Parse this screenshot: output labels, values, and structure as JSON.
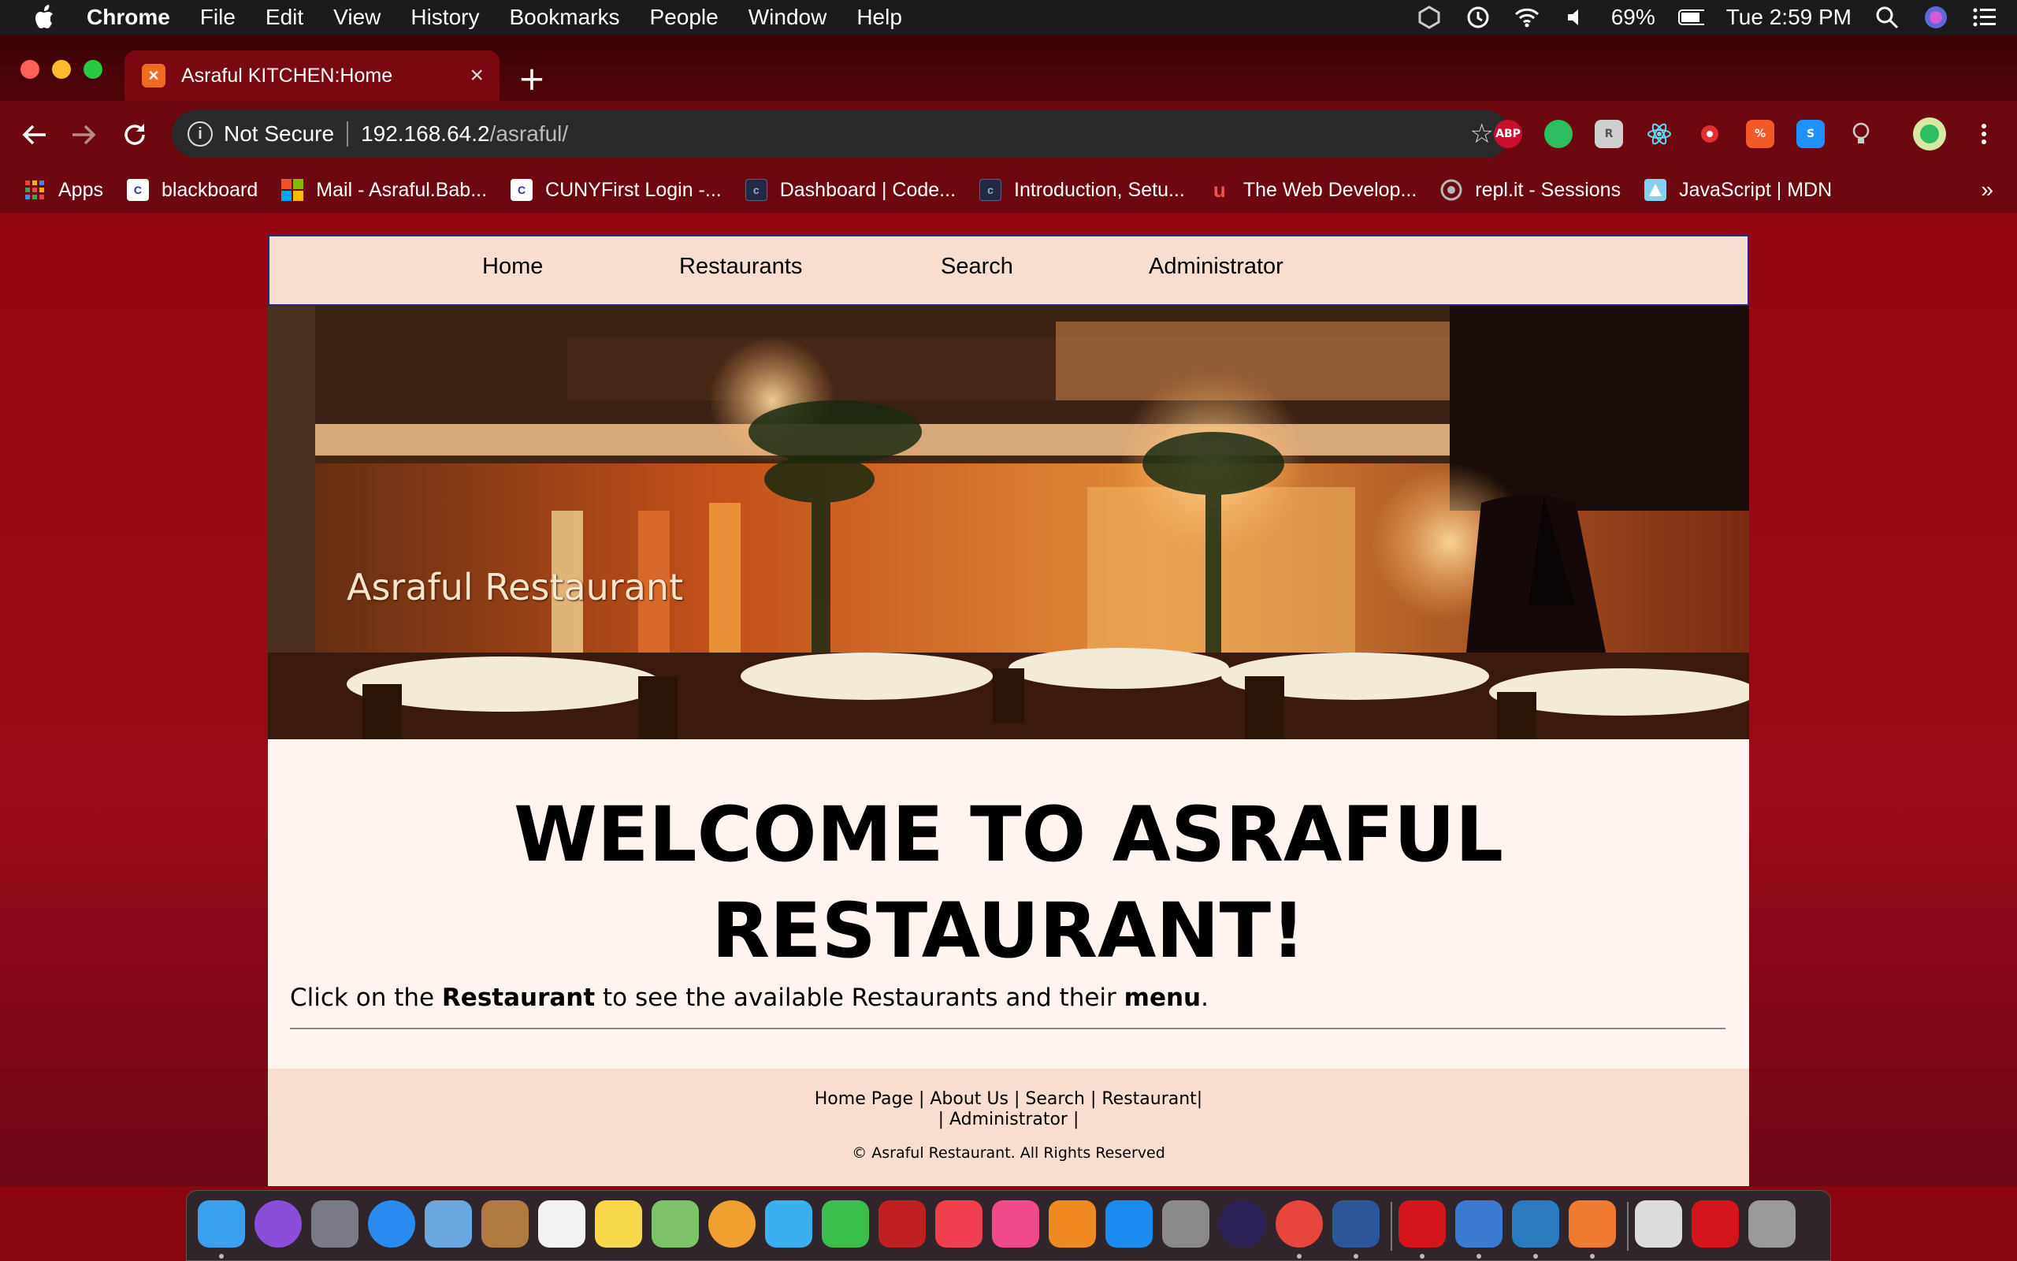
{
  "menubar": {
    "app_name": "Chrome",
    "items": [
      "File",
      "Edit",
      "View",
      "History",
      "Bookmarks",
      "People",
      "Window",
      "Help"
    ],
    "battery": "69%",
    "clock": "Tue 2:59 PM"
  },
  "browser": {
    "tab_title": "Asraful KITCHEN:Home",
    "security_label": "Not Secure",
    "url_host": "192.168.64.2",
    "url_path": "/asraful/",
    "extensions": [
      {
        "name": "adblock-icon",
        "text": "ABP",
        "color": "#c8102e"
      },
      {
        "name": "evernote-icon",
        "text": "",
        "color": "#2dbe60"
      },
      {
        "name": "extension-icon",
        "text": "R",
        "color": "#cfcfcf"
      },
      {
        "name": "react-devtools-icon",
        "text": "",
        "color": "#61dafb"
      },
      {
        "name": "extension-red-icon",
        "text": "",
        "color": "#e03030"
      },
      {
        "name": "extension-orange-icon",
        "text": "%",
        "color": "#f05a28"
      },
      {
        "name": "extension-blue-icon",
        "text": "S",
        "color": "#1e90ff"
      },
      {
        "name": "lightbulb-icon",
        "text": "",
        "color": "#777"
      }
    ]
  },
  "bookmarks": [
    {
      "label": "Apps",
      "icon": "apps-grid-icon",
      "color": "#e8453c"
    },
    {
      "label": "blackboard",
      "icon": "cuny-icon",
      "color": "#1f3a93"
    },
    {
      "label": "Mail - Asraful.Bab...",
      "icon": "microsoft-icon",
      "color": "#f25022"
    },
    {
      "label": "CUNYFirst Login -...",
      "icon": "cuny-icon",
      "color": "#1f3a93"
    },
    {
      "label": "Dashboard | Code...",
      "icon": "codecademy-icon",
      "color": "#1f2a44"
    },
    {
      "label": "Introduction, Setu...",
      "icon": "codecademy-icon",
      "color": "#1f2a44"
    },
    {
      "label": "The Web Develop...",
      "icon": "udemy-icon",
      "color": "#ec5252"
    },
    {
      "label": "repl.it - Sessions",
      "icon": "replit-icon",
      "color": "#667881"
    },
    {
      "label": "JavaScript | MDN",
      "icon": "mdn-icon",
      "color": "#83d0f2"
    }
  ],
  "site": {
    "nav": [
      "Home",
      "Restaurants",
      "Search",
      "Administrator"
    ],
    "hero_title": "Asraful Restaurant",
    "welcome_line1": "WELCOME TO ASRAFUL",
    "welcome_line2": "RESTAURANT!",
    "intro_pre": "Click on the ",
    "intro_bold1": "Restaurant",
    "intro_mid": " to see the available Restaurants and their ",
    "intro_bold2": "menu",
    "intro_post": ".",
    "footer_links1": "Home Page | About Us | Search | Restaurant|",
    "footer_links2": "| Administrator |",
    "footer_copy": "© Asraful Restaurant. All Rights Reserved"
  },
  "dock": [
    {
      "name": "finder-icon",
      "color": "#3aa0f0"
    },
    {
      "name": "siri-icon",
      "color": "#8a4fd8"
    },
    {
      "name": "launchpad-icon",
      "color": "#7a7a86"
    },
    {
      "name": "safari-icon",
      "color": "#2a8cf0"
    },
    {
      "name": "mail-bird-icon",
      "color": "#6aa6e0"
    },
    {
      "name": "contacts-icon",
      "color": "#b07a40"
    },
    {
      "name": "calendar-icon",
      "color": "#f2f2f2"
    },
    {
      "name": "notes-icon",
      "color": "#f7d84a"
    },
    {
      "name": "maps-icon",
      "color": "#7cc36a"
    },
    {
      "name": "photos-icon",
      "color": "#f0a030"
    },
    {
      "name": "messages-icon",
      "color": "#3ab0f0"
    },
    {
      "name": "facetime-icon",
      "color": "#3ac04a"
    },
    {
      "name": "photo-booth-icon",
      "color": "#c02020"
    },
    {
      "name": "news-icon",
      "color": "#f04050"
    },
    {
      "name": "music-icon",
      "color": "#f04a8a"
    },
    {
      "name": "books-icon",
      "color": "#f08a20"
    },
    {
      "name": "app-store-icon",
      "color": "#1a8cf0"
    },
    {
      "name": "system-preferences-icon",
      "color": "#8a8a8a"
    },
    {
      "name": "eclipse-icon",
      "color": "#2c2255"
    },
    {
      "name": "chrome-icon",
      "color": "#e8453c"
    },
    {
      "name": "word-icon",
      "color": "#2b579a"
    },
    {
      "name": "acrobat-icon",
      "color": "#d4161c"
    },
    {
      "name": "xcode-instruments-icon",
      "color": "#3a7ad0"
    },
    {
      "name": "vscode-icon",
      "color": "#2a7ac0"
    },
    {
      "name": "xampp-icon",
      "color": "#f07a30"
    },
    {
      "name": "document-icon",
      "color": "#dcdcdc"
    },
    {
      "name": "acrobat-doc-icon",
      "color": "#d4161c"
    },
    {
      "name": "trash-icon",
      "color": "#9a9a9a"
    }
  ]
}
